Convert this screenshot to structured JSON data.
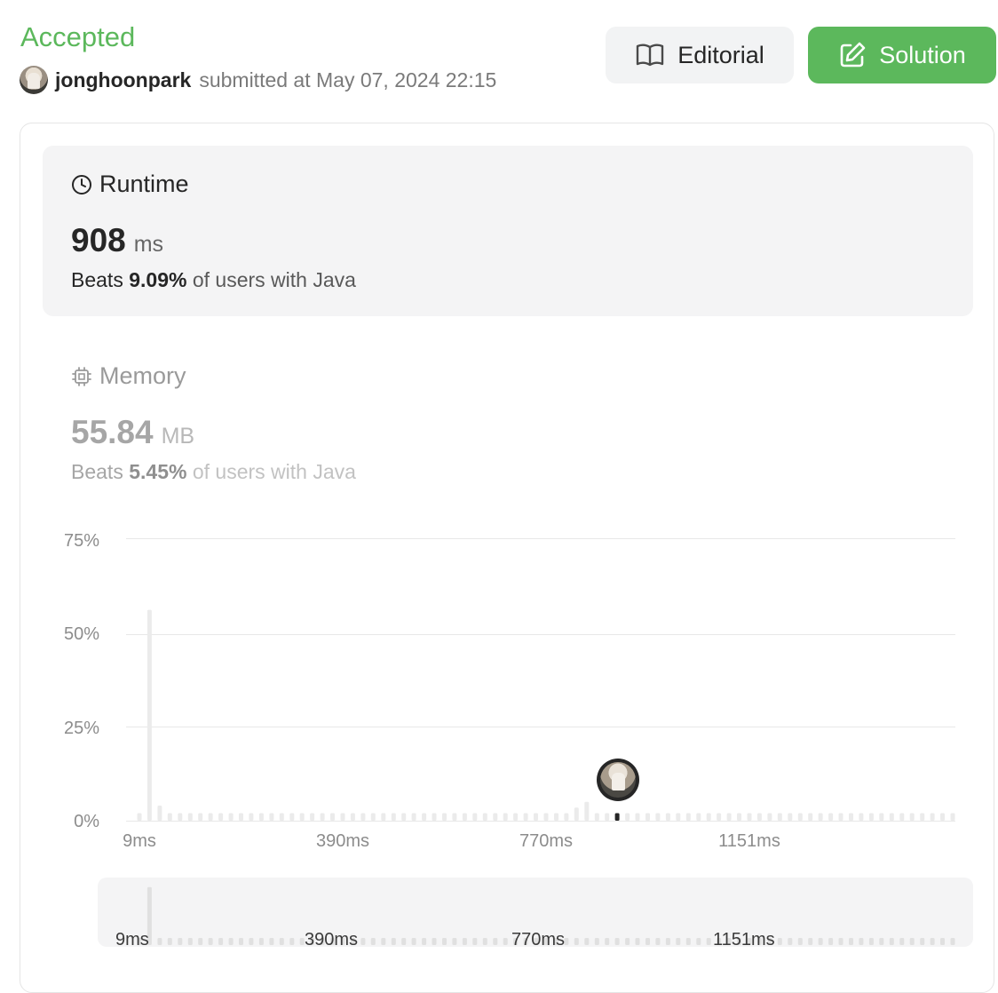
{
  "header": {
    "status": "Accepted",
    "username": "jonghoonpark",
    "submitted_text": "submitted at May 07, 2024 22:15"
  },
  "buttons": {
    "editorial": "Editorial",
    "solution": "Solution"
  },
  "runtime": {
    "title": "Runtime",
    "value": "908",
    "unit": "ms",
    "beats_prefix": "Beats",
    "beats_value": "9.09%",
    "beats_suffix": "of users with Java"
  },
  "memory": {
    "title": "Memory",
    "value": "55.84",
    "unit": "MB",
    "beats_prefix": "Beats",
    "beats_value": "5.45%",
    "beats_suffix": "of users with Java"
  },
  "chart_data": {
    "type": "bar",
    "title": "",
    "xlabel": "",
    "ylabel": "",
    "y_ticks": [
      "0%",
      "25%",
      "50%",
      "75%"
    ],
    "x_ticks": [
      "9ms",
      "390ms",
      "770ms",
      "1151ms"
    ],
    "ylim": [
      0,
      75
    ],
    "grid": true,
    "highlight_value_ms": 908,
    "series": [
      {
        "values": [
          2,
          56,
          4,
          2,
          2,
          2,
          2,
          2,
          2,
          2,
          2,
          2,
          2,
          2,
          2,
          2,
          2,
          2,
          2,
          2,
          2,
          2,
          2,
          2,
          2,
          2,
          2,
          2,
          2,
          2,
          2,
          2,
          2,
          2,
          2,
          2,
          2,
          2,
          2,
          2,
          2,
          2,
          2,
          3.5,
          5,
          2,
          2,
          2,
          2,
          2,
          2,
          2,
          2,
          2,
          2,
          2,
          2,
          2,
          2,
          2,
          2,
          2,
          2,
          2,
          2,
          2,
          2,
          2,
          2,
          2,
          2,
          2,
          2,
          2,
          2,
          2,
          2,
          2,
          2,
          2,
          2
        ]
      }
    ],
    "highlight_index": 47
  },
  "range_slider": {
    "labels": [
      "9ms",
      "390ms",
      "770ms",
      "1151ms"
    ]
  }
}
